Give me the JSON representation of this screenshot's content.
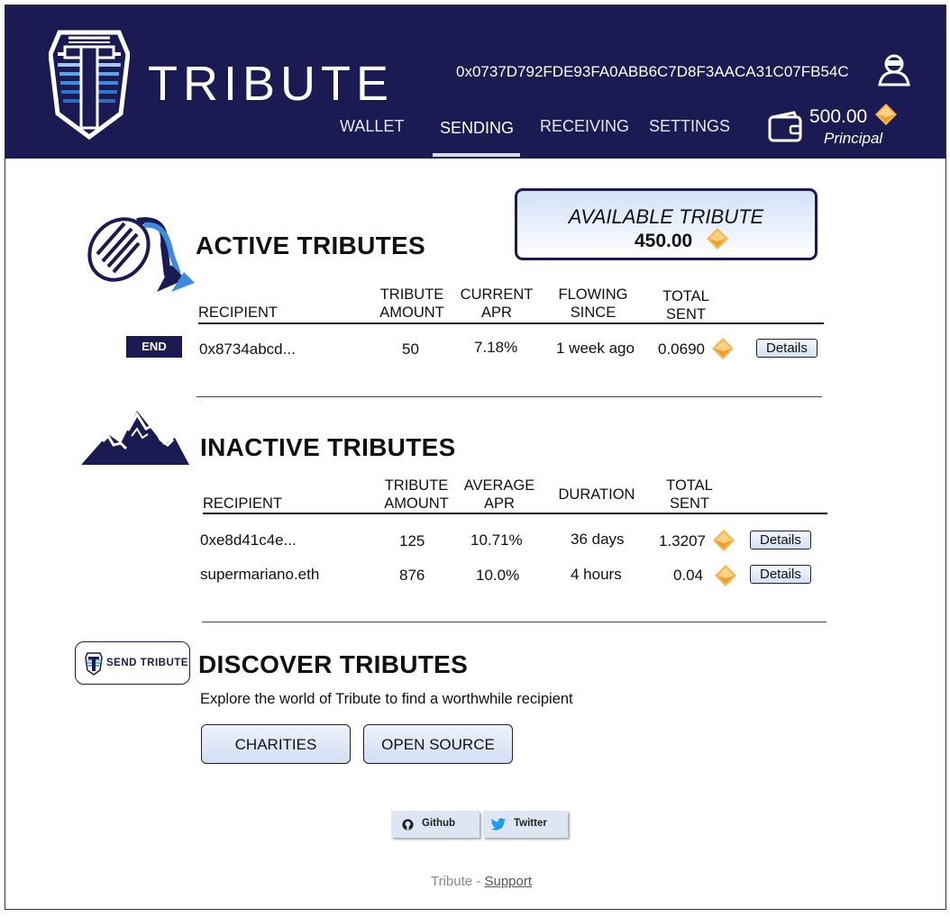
{
  "header": {
    "brand": "TRIBUTE",
    "address": "0x0737D792FDE93FA0ABB6C7D8F3AACA31C07FB54C",
    "nav": {
      "wallet": "WALLET",
      "sending": "SENDING",
      "receiving": "RECEIVING",
      "settings": "SETTINGS"
    },
    "active_tab": "SENDING",
    "principal_amount": "500.00",
    "principal_label": "Principal"
  },
  "available": {
    "title": "AVAILABLE TRIBUTE",
    "value": "450.00"
  },
  "active": {
    "title": "ACTIVE TRIBUTES",
    "end_label": "END",
    "columns": {
      "recipient": "RECIPIENT",
      "amount_1": "TRIBUTE",
      "amount_2": "AMOUNT",
      "apr_1": "CURRENT",
      "apr_2": "APR",
      "since_1": "FLOWING",
      "since_2": "SINCE",
      "sent_1": "TOTAL",
      "sent_2": "SENT"
    },
    "rows": [
      {
        "recipient": "0x8734abcd...",
        "amount": "50",
        "apr": "7.18%",
        "since": "1 week ago",
        "sent": "0.0690",
        "details": "Details"
      }
    ]
  },
  "inactive": {
    "title": "INACTIVE TRIBUTES",
    "columns": {
      "recipient": "RECIPIENT",
      "amount_1": "TRIBUTE",
      "amount_2": "AMOUNT",
      "apr_1": "AVERAGE",
      "apr_2": "APR",
      "duration": "DURATION",
      "sent_1": "TOTAL",
      "sent_2": "SENT"
    },
    "rows": [
      {
        "recipient": "0xe8d41c4e...",
        "amount": "125",
        "apr": "10.71%",
        "duration": "36 days",
        "sent": "1.3207",
        "details": "Details"
      },
      {
        "recipient": "supermariano.eth",
        "amount": "876",
        "apr": "10.0%",
        "duration": "4 hours",
        "sent": "0.04",
        "details": "Details"
      }
    ]
  },
  "discover": {
    "title": "DISCOVER TRIBUTES",
    "send_button": "SEND TRIBUTE",
    "description": "Explore the world of Tribute to find a worthwhile recipient",
    "categories": [
      "CHARITIES",
      "OPEN SOURCE"
    ]
  },
  "social": {
    "github": "Github",
    "twitter": "Twitter"
  },
  "footer": {
    "brand": "Tribute - ",
    "support": "Support"
  },
  "colors": {
    "navy": "#1b1a53",
    "token_orange": "#f5a93f",
    "button_blue": "#d3def3"
  }
}
